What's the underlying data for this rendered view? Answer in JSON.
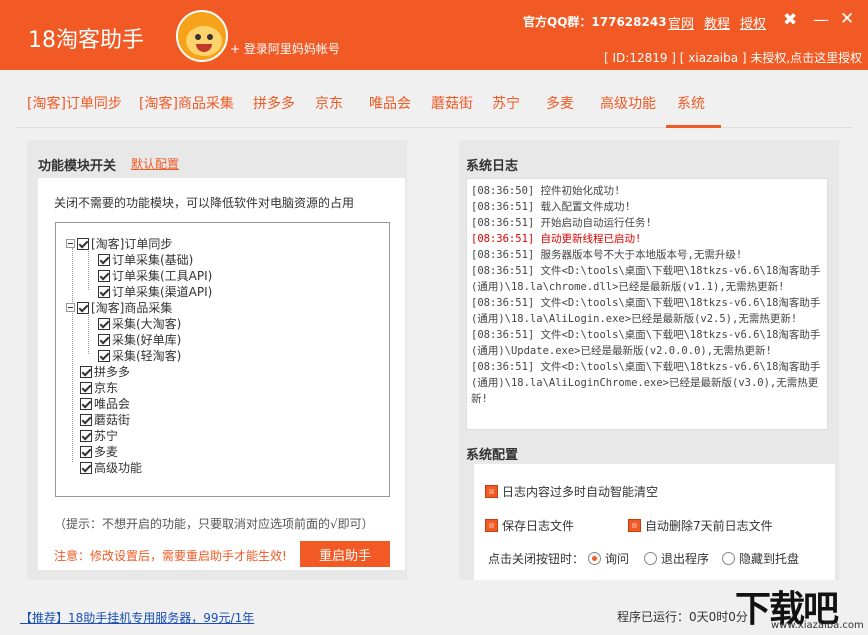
{
  "header": {
    "app_title": "18淘客助手",
    "login_label": "+ 登录阿里妈妈帐号",
    "qq_label": "官方QQ群：177628243",
    "links": [
      "官网",
      "教程",
      "授权"
    ],
    "status": "[ ID:12819 ] [ xiazaiba ] 未授权,点击这里授权"
  },
  "tabs": [
    "[淘客]订单同步",
    "[淘客]商品采集",
    "拼多多",
    "京东",
    "唯品会",
    "蘑菇街",
    "苏宁",
    "多麦",
    "高级功能",
    "系统"
  ],
  "active_tab": "系统",
  "left": {
    "title": "功能模块开关",
    "default_link": "默认配置",
    "hint_top": "关闭不需要的功能模块，可以降低软件对电脑资源的占用",
    "tree": [
      {
        "label": "[淘客]订单同步",
        "level": 0,
        "expander": true
      },
      {
        "label": "订单采集(基础)",
        "level": 1
      },
      {
        "label": "订单采集(工具API)",
        "level": 1
      },
      {
        "label": "订单采集(渠道API)",
        "level": 1
      },
      {
        "label": "[淘客]商品采集",
        "level": 0,
        "expander": true
      },
      {
        "label": "采集(大淘客)",
        "level": 1
      },
      {
        "label": "采集(好单库)",
        "level": 1
      },
      {
        "label": "采集(轻淘客)",
        "level": 1
      },
      {
        "label": "拼多多",
        "level": 0
      },
      {
        "label": "京东",
        "level": 0
      },
      {
        "label": "唯品会",
        "level": 0
      },
      {
        "label": "蘑菇街",
        "level": 0
      },
      {
        "label": "苏宁",
        "level": 0
      },
      {
        "label": "多麦",
        "level": 0
      },
      {
        "label": "高级功能",
        "level": 0
      }
    ],
    "hint_bottom": "（提示：不想开启的功能，只要取消对应选项前面的√即可）",
    "notice": "注意：修改设置后，需要重启助手才能生效!",
    "restart_label": "重启助手"
  },
  "right": {
    "log_title": "系统日志",
    "logs": [
      {
        "text": "[08:36:50] 控件初始化成功!",
        "error": false
      },
      {
        "text": "[08:36:51] 载入配置文件成功!",
        "error": false
      },
      {
        "text": "[08:36:51] 开始启动自动运行任务!",
        "error": false
      },
      {
        "text": "[08:36:51] 自动更新线程已启动!",
        "error": true
      },
      {
        "text": "[08:36:51] 服务器版本号不大于本地版本号,无需升级!",
        "error": false
      },
      {
        "text": "[08:36:51] 文件<D:\\tools\\桌面\\下载吧\\18tkzs-v6.6\\18淘客助手(通用)\\18.la\\chrome.dll>已经是最新版(v1.1),无需热更新!",
        "error": false
      },
      {
        "text": "[08:36:51] 文件<D:\\tools\\桌面\\下载吧\\18tkzs-v6.6\\18淘客助手(通用)\\18.la\\AliLogin.exe>已经是最新版(v2.5),无需热更新!",
        "error": false
      },
      {
        "text": "[08:36:51] 文件<D:\\tools\\桌面\\下载吧\\18tkzs-v6.6\\18淘客助手(通用)\\Update.exe>已经是最新版(v2.0.0.0),无需热更新!",
        "error": false
      },
      {
        "text": "[08:36:51] 文件<D:\\tools\\桌面\\下载吧\\18tkzs-v6.6\\18淘客助手(通用)\\18.la\\AliLoginChrome.exe>已经是最新版(v3.0),无需热更新!",
        "error": false
      }
    ],
    "config_title": "系统配置",
    "auto_clear_label": "日志内容过多时自动智能清空",
    "save_log_label": "保存日志文件",
    "auto_delete_label": "自动删除7天前日志文件",
    "close_action_label": "点击关闭按钮时：",
    "close_options": [
      "询问",
      "退出程序",
      "隐藏到托盘"
    ],
    "close_selected": "询问"
  },
  "footer": {
    "promo": "【推荐】18助手挂机专用服务器，99元/1年",
    "runtime": "程序已运行：0天0时0分"
  },
  "watermark": {
    "big": "下载吧",
    "small": "www.xiazaiba.com"
  },
  "colors": {
    "accent": "#f15a24",
    "link": "#1a4fb3",
    "error": "#dd0000"
  }
}
